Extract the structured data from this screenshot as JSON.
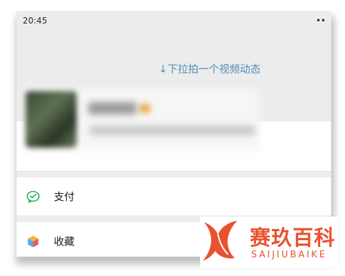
{
  "status_bar": {
    "time": "20:45",
    "indicator": "••"
  },
  "moments_hint": {
    "text": "↓下拉拍一个视频动态",
    "icon": "arrow-down-icon",
    "color": "#4f8fb8"
  },
  "menu": {
    "items": [
      {
        "label": "支付",
        "icon": "wechat-pay-icon",
        "icon_color": "#21b05d"
      },
      {
        "label": "收藏",
        "icon": "favorites-cube-icon",
        "icon_color": "#f2b43a"
      }
    ]
  },
  "watermark": {
    "title": "赛玖百科",
    "subtitle": "SAIJIUBAIKE",
    "color": "#e8532f"
  }
}
